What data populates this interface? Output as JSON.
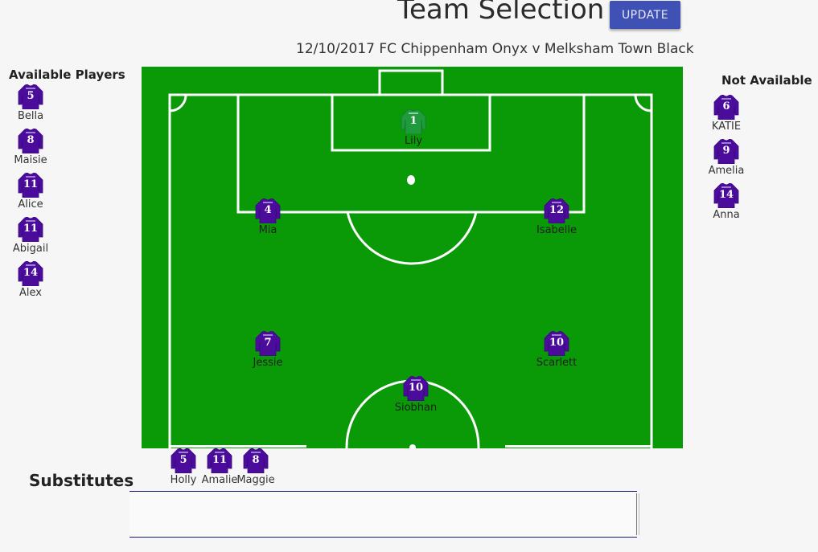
{
  "header": {
    "title": "Team Selection",
    "update_label": "UPDATE",
    "fixture": "12/10/2017 FC Chippenham Onyx v Melksham Town Black"
  },
  "colors": {
    "pitch": "#0a9a08",
    "shirt_outfield": "#4b0c9c",
    "shirt_keeper": "#1f9a3c",
    "button": "#3f51b5"
  },
  "available": {
    "heading": "Available Players",
    "players": [
      {
        "name": "Bella",
        "number": "5"
      },
      {
        "name": "Maisie",
        "number": "8"
      },
      {
        "name": "Alice",
        "number": "11"
      },
      {
        "name": "Abigail",
        "number": "11"
      },
      {
        "name": "Alex",
        "number": "14"
      }
    ]
  },
  "not_available": {
    "heading": "Not Available",
    "players": [
      {
        "name": "KATIE",
        "number": "6"
      },
      {
        "name": "Amelia",
        "number": "9"
      },
      {
        "name": "Anna",
        "number": "14"
      }
    ]
  },
  "pitch": {
    "players": [
      {
        "name": "Lily",
        "number": "1",
        "keeper": true
      },
      {
        "name": "Mia",
        "number": "4"
      },
      {
        "name": "Isabelle",
        "number": "12"
      },
      {
        "name": "Jessie",
        "number": "7"
      },
      {
        "name": "Scarlett",
        "number": "10"
      },
      {
        "name": "Siobhan",
        "number": "10"
      }
    ]
  },
  "substitutes": {
    "heading": "Substitutes",
    "players": [
      {
        "name": "Holly",
        "number": "5"
      },
      {
        "name": "Amalie",
        "number": "11"
      },
      {
        "name": "Maggie",
        "number": "8"
      }
    ]
  }
}
